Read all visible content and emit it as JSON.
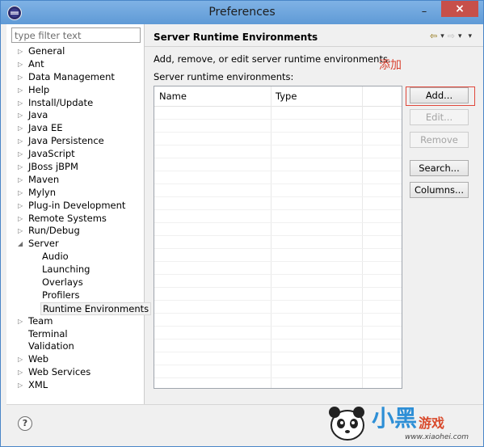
{
  "window": {
    "title": "Preferences"
  },
  "titlebar": {
    "minimize": "–",
    "close": "×"
  },
  "filter": {
    "placeholder": "type filter text"
  },
  "tree": [
    {
      "label": "General",
      "arrow": "▷",
      "level": 0
    },
    {
      "label": "Ant",
      "arrow": "▷",
      "level": 0
    },
    {
      "label": "Data Management",
      "arrow": "▷",
      "level": 0
    },
    {
      "label": "Help",
      "arrow": "▷",
      "level": 0
    },
    {
      "label": "Install/Update",
      "arrow": "▷",
      "level": 0
    },
    {
      "label": "Java",
      "arrow": "▷",
      "level": 0
    },
    {
      "label": "Java EE",
      "arrow": "▷",
      "level": 0
    },
    {
      "label": "Java Persistence",
      "arrow": "▷",
      "level": 0
    },
    {
      "label": "JavaScript",
      "arrow": "▷",
      "level": 0
    },
    {
      "label": "JBoss jBPM",
      "arrow": "▷",
      "level": 0
    },
    {
      "label": "Maven",
      "arrow": "▷",
      "level": 0
    },
    {
      "label": "Mylyn",
      "arrow": "▷",
      "level": 0
    },
    {
      "label": "Plug-in Development",
      "arrow": "▷",
      "level": 0
    },
    {
      "label": "Remote Systems",
      "arrow": "▷",
      "level": 0
    },
    {
      "label": "Run/Debug",
      "arrow": "▷",
      "level": 0
    },
    {
      "label": "Server",
      "arrow": "◢",
      "level": 0
    },
    {
      "label": "Audio",
      "arrow": "",
      "level": 1
    },
    {
      "label": "Launching",
      "arrow": "",
      "level": 1
    },
    {
      "label": "Overlays",
      "arrow": "",
      "level": 1
    },
    {
      "label": "Profilers",
      "arrow": "",
      "level": 1
    },
    {
      "label": "Runtime Environments",
      "arrow": "",
      "level": 1,
      "selected": true
    },
    {
      "label": "Team",
      "arrow": "▷",
      "level": 0
    },
    {
      "label": "Terminal",
      "arrow": "",
      "level": 0
    },
    {
      "label": "Validation",
      "arrow": "",
      "level": 0
    },
    {
      "label": "Web",
      "arrow": "▷",
      "level": 0
    },
    {
      "label": "Web Services",
      "arrow": "▷",
      "level": 0
    },
    {
      "label": "XML",
      "arrow": "▷",
      "level": 0
    }
  ],
  "page": {
    "title": "Server Runtime Environments",
    "description": "Add, remove, or edit server runtime environments.",
    "annotation": "添加",
    "list_label": "Server runtime environments:",
    "columns": [
      "Name",
      "Type"
    ],
    "nav": {
      "back": "⇦",
      "back_menu": "▾",
      "forward": "⇨",
      "forward_menu": "▾",
      "view_menu": "▾"
    }
  },
  "buttons": {
    "add": "Add...",
    "edit": "Edit...",
    "remove": "Remove",
    "search": "Search...",
    "columns": "Columns..."
  },
  "help": {
    "icon": "?"
  },
  "watermark": {
    "text": "小黑",
    "text2": "游戏",
    "url": "www.xiaohei.com"
  }
}
